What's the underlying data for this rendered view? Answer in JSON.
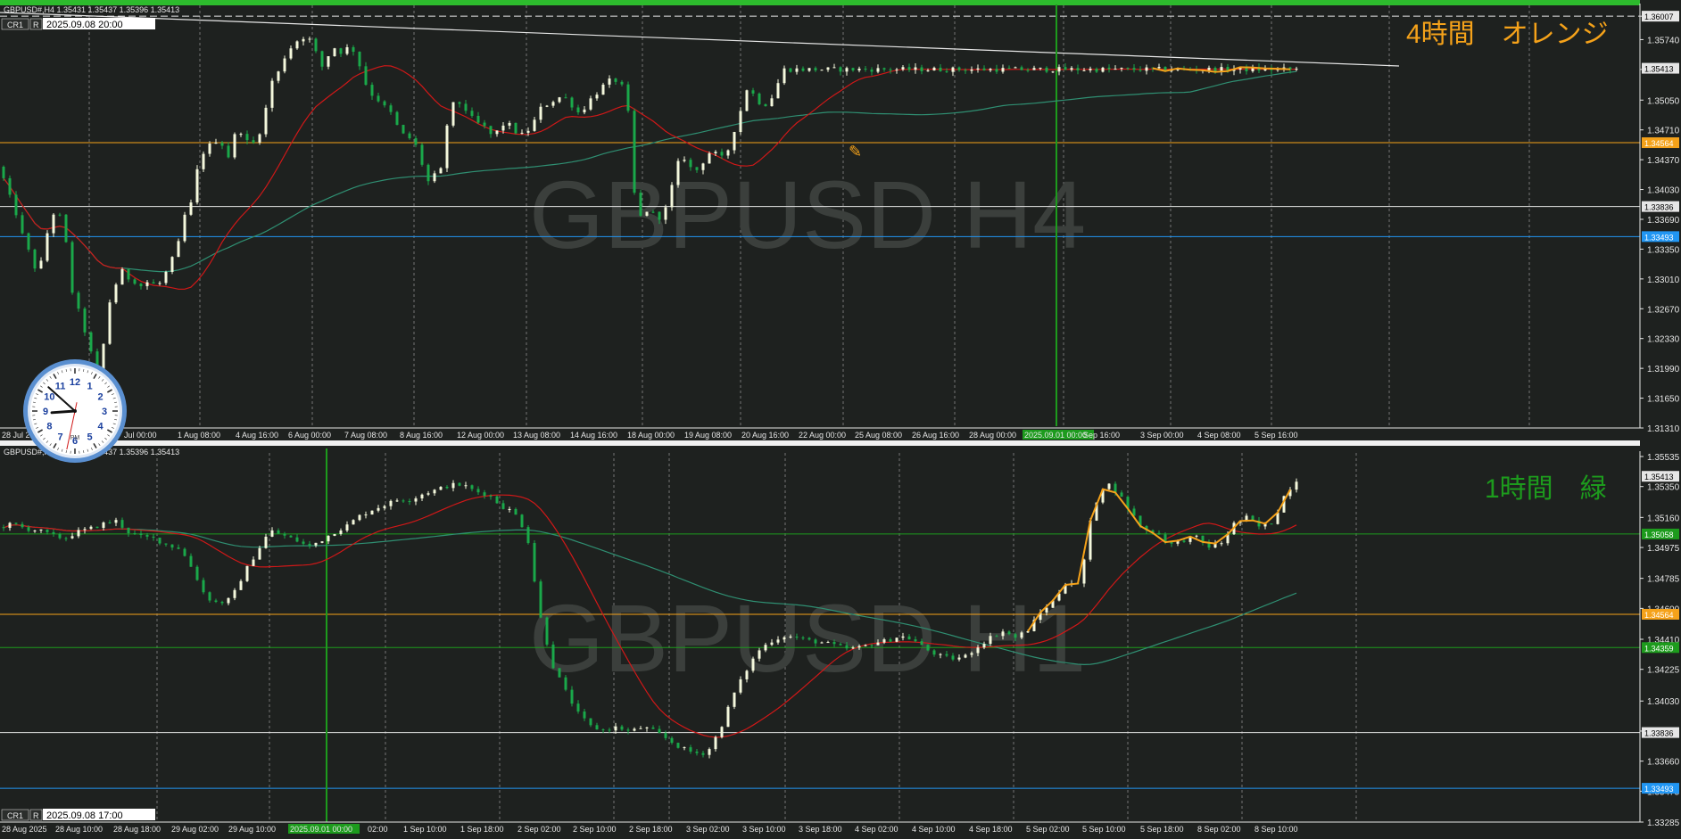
{
  "colors": {
    "background": "#1e211f",
    "axis_text": "#e6e6e6",
    "bull_candle": "#f4f8dc",
    "bear_candle": "#1aa84a",
    "ma_red": "#d01818",
    "ma_teal": "#2f8f72",
    "zigzag_orange": "#f5a21a",
    "watermark": "#3b3f3c",
    "level_orange": "#f5a21a",
    "level_white": "#e6e6e6",
    "level_blue": "#2196f3",
    "level_green": "#1d9b1d",
    "vline_green": "#1d9b1d",
    "grid": "#9a9a9a",
    "top_bar": "#2dbb2d"
  },
  "panels": [
    {
      "id": "h4",
      "info": "GBPUSD#,H4  1.35431 1.35437 1.35396 1.35413",
      "button_cr": "CR1",
      "button_r": "R",
      "datetime": "2025.09.08 20:00",
      "watermark": "GBPUSD H4",
      "note": "4時間　オレンジ",
      "note_color": "#f5a21a",
      "current_price": "1.35413",
      "price_ticks": [
        "1.36007",
        "1.35740",
        "1.35400",
        "1.35050",
        "1.34710",
        "1.34370",
        "1.34030",
        "1.33690",
        "1.33350",
        "1.33010",
        "1.32670",
        "1.32330",
        "1.31990",
        "1.31650",
        "1.31310"
      ],
      "levels": [
        {
          "price": "1.36007",
          "color": "#e6e6e6",
          "style": "dash"
        },
        {
          "price": "1.34564",
          "color": "#f5a21a",
          "style": "solid"
        },
        {
          "price": "1.33836",
          "color": "#e6e6e6",
          "style": "solid"
        },
        {
          "price": "1.33493",
          "color": "#2196f3",
          "style": "solid"
        }
      ],
      "time_labels": [
        "28 Jul 2025",
        "Jul 00:00",
        "1 Aug 08:00",
        "4 Aug 16:00",
        "6 Aug 00:00",
        "7 Aug 08:00",
        "8 Aug 16:00",
        "12 Aug 00:00",
        "13 Aug 08:00",
        "14 Aug 16:00",
        "18 Aug 00:00",
        "19 Aug 08:00",
        "20 Aug 16:00",
        "22 Aug 00:00",
        "25 Aug 08:00",
        "26 Aug 16:00",
        "28 Aug 00:00",
        "2025.09.01 00:00",
        "Sep 16:00",
        "3 Sep 00:00",
        "4 Sep 08:00",
        "5 Sep 16:00"
      ],
      "highlight_time": "2025.09.01 00:00"
    },
    {
      "id": "h1",
      "info": "GBPUSD#,H1  1.35431 1.35437 1.35396 1.35413",
      "button_cr": "CR1",
      "button_r": "R",
      "datetime": "2025.09.08 17:00",
      "watermark": "GBPUSD H1",
      "note": "1時間　緑",
      "note_color": "#1d9b1d",
      "current_price": "1.35413",
      "price_ticks": [
        "1.35535",
        "1.35350",
        "1.35160",
        "1.34975",
        "1.34785",
        "1.34600",
        "1.34410",
        "1.34225",
        "1.34030",
        "1.33845",
        "1.33660",
        "1.33475",
        "1.33285"
      ],
      "levels": [
        {
          "price": "1.35058",
          "color": "#1d9b1d",
          "style": "solid"
        },
        {
          "price": "1.34564",
          "color": "#f5a21a",
          "style": "solid"
        },
        {
          "price": "1.34359",
          "color": "#1d9b1d",
          "style": "solid"
        },
        {
          "price": "1.33836",
          "color": "#e6e6e6",
          "style": "solid"
        },
        {
          "price": "1.33493",
          "color": "#2196f3",
          "style": "solid"
        }
      ],
      "time_labels": [
        "28 Aug 2025",
        "28 Aug 10:00",
        "28 Aug 18:00",
        "29 Aug 02:00",
        "29 Aug 10:00",
        "2025.09.01 00:00",
        "02:00",
        "1 Sep 10:00",
        "1 Sep 18:00",
        "2 Sep 02:00",
        "2 Sep 10:00",
        "2 Sep 18:00",
        "3 Sep 02:00",
        "3 Sep 10:00",
        "3 Sep 18:00",
        "4 Sep 02:00",
        "4 Sep 10:00",
        "4 Sep 18:00",
        "5 Sep 02:00",
        "5 Sep 10:00",
        "5 Sep 18:00",
        "8 Sep 02:00",
        "8 Sep 10:00"
      ],
      "highlight_time": "2025.09.01 00:00"
    }
  ],
  "clock": {
    "numbers": [
      "12",
      "1",
      "2",
      "3",
      "4",
      "5",
      "6",
      "7",
      "8",
      "9",
      "10",
      "11"
    ],
    "ampm": "PM",
    "hour": 8,
    "minute": 52,
    "second": 32
  },
  "chart_data": [
    {
      "type": "candlestick",
      "title": "GBPUSD H4",
      "ylim": [
        1.3131,
        1.3609
      ],
      "x_range": [
        "28 Jul 2025",
        "8 Sep 2025 20:00"
      ],
      "series": [
        {
          "name": "close_path_approx",
          "values": [
            [
              0,
              1.3429
            ],
            [
              8,
              1.3401
            ],
            [
              16,
              1.3383
            ],
            [
              24,
              1.3354
            ],
            [
              32,
              1.3333
            ],
            [
              40,
              1.3312
            ],
            [
              48,
              1.3322
            ],
            [
              56,
              1.3371
            ],
            [
              64,
              1.338
            ],
            [
              72,
              1.336
            ],
            [
              80,
              1.329
            ],
            [
              88,
              1.3265
            ],
            [
              96,
              1.3239
            ],
            [
              104,
              1.321
            ],
            [
              112,
              1.3183
            ],
            [
              120,
              1.3265
            ],
            [
              128,
              1.3289
            ],
            [
              136,
              1.3311
            ],
            [
              144,
              1.3302
            ],
            [
              152,
              1.3298
            ],
            [
              160,
              1.3292
            ],
            [
              168,
              1.33
            ],
            [
              176,
              1.3291
            ],
            [
              184,
              1.3303
            ],
            [
              192,
              1.332
            ],
            [
              200,
              1.334
            ],
            [
              208,
              1.3376
            ],
            [
              216,
              1.3389
            ],
            [
              224,
              1.3441
            ],
            [
              232,
              1.3449
            ],
            [
              240,
              1.3459
            ],
            [
              248,
              1.3458
            ],
            [
              256,
              1.3439
            ],
            [
              264,
              1.3466
            ],
            [
              272,
              1.347
            ],
            [
              280,
              1.3452
            ],
            [
              288,
              1.3459
            ],
            [
              296,
              1.3481
            ],
            [
              304,
              1.3525
            ],
            [
              312,
              1.3535
            ],
            [
              320,
              1.3555
            ],
            [
              328,
              1.3567
            ],
            [
              336,
              1.3575
            ],
            [
              344,
              1.3578
            ],
            [
              352,
              1.3569
            ],
            [
              360,
              1.354
            ],
            [
              368,
              1.3555
            ],
            [
              376,
              1.3565
            ],
            [
              384,
              1.3559
            ],
            [
              392,
              1.3566
            ],
            [
              400,
              1.3559
            ],
            [
              408,
              1.3529
            ],
            [
              416,
              1.3513
            ],
            [
              424,
              1.3506
            ],
            [
              432,
              1.3497
            ],
            [
              440,
              1.3489
            ],
            [
              448,
              1.3471
            ],
            [
              456,
              1.3462
            ],
            [
              464,
              1.3461
            ],
            [
              472,
              1.3439
            ],
            [
              480,
              1.3411
            ],
            [
              488,
              1.3419
            ],
            [
              496,
              1.3426
            ],
            [
              504,
              1.3493
            ],
            [
              512,
              1.3504
            ],
            [
              520,
              1.3499
            ],
            [
              528,
              1.3486
            ],
            [
              536,
              1.3479
            ],
            [
              544,
              1.3474
            ],
            [
              552,
              1.3465
            ],
            [
              560,
              1.347
            ],
            [
              568,
              1.3481
            ],
            [
              576,
              1.3472
            ],
            [
              584,
              1.3464
            ],
            [
              592,
              1.3469
            ],
            [
              600,
              1.3481
            ],
            [
              608,
              1.3497
            ],
            [
              616,
              1.3501
            ],
            [
              624,
              1.3506
            ],
            [
              632,
              1.351
            ],
            [
              640,
              1.3503
            ],
            [
              648,
              1.349
            ],
            [
              656,
              1.3496
            ],
            [
              664,
              1.3507
            ],
            [
              672,
              1.3515
            ],
            [
              680,
              1.3524
            ],
            [
              688,
              1.3529
            ],
            [
              696,
              1.3525
            ],
            [
              704,
              1.351
            ],
            [
              712,
              1.34
            ],
            [
              720,
              1.337
            ],
            [
              728,
              1.3381
            ],
            [
              736,
              1.3373
            ],
            [
              744,
              1.337
            ],
            [
              752,
              1.3395
            ],
            [
              760,
              1.3431
            ],
            [
              768,
              1.344
            ],
            [
              776,
              1.3427
            ],
            [
              784,
              1.3425
            ],
            [
              792,
              1.3439
            ],
            [
              800,
              1.3449
            ],
            [
              808,
              1.3437
            ],
            [
              816,
              1.3443
            ],
            [
              824,
              1.3469
            ],
            [
              832,
              1.3494
            ],
            [
              840,
              1.3522
            ],
            [
              848,
              1.3508
            ],
            [
              856,
              1.3499
            ],
            [
              864,
              1.3502
            ],
            [
              872,
              1.352
            ],
            [
              880,
              1.354
            ]
          ]
        }
      ]
    },
    {
      "type": "candlestick",
      "title": "GBPUSD H1",
      "ylim": [
        1.33285,
        1.35535
      ],
      "x_range": [
        "28 Aug 2025",
        "8 Sep 2025 17:00"
      ],
      "series": [
        {
          "name": "close_path_approx",
          "values": [
            [
              0,
              1.351
            ],
            [
              10,
              1.3512
            ],
            [
              20,
              1.3509
            ],
            [
              30,
              1.3508
            ],
            [
              40,
              1.3505
            ],
            [
              50,
              1.3503
            ],
            [
              60,
              1.3507
            ],
            [
              70,
              1.3509
            ],
            [
              80,
              1.3512
            ],
            [
              90,
              1.3514
            ],
            [
              100,
              1.3507
            ],
            [
              110,
              1.3504
            ],
            [
              120,
              1.3503
            ],
            [
              130,
              1.3499
            ],
            [
              140,
              1.3497
            ],
            [
              150,
              1.3484
            ],
            [
              160,
              1.3467
            ],
            [
              170,
              1.3463
            ],
            [
              180,
              1.3466
            ],
            [
              190,
              1.3482
            ],
            [
              200,
              1.3495
            ],
            [
              210,
              1.3508
            ],
            [
              220,
              1.3505
            ],
            [
              230,
              1.3502
            ],
            [
              240,
              1.3498
            ],
            [
              250,
              1.3502
            ],
            [
              260,
              1.3507
            ],
            [
              270,
              1.3511
            ],
            [
              280,
              1.3517
            ],
            [
              290,
              1.3521
            ],
            [
              300,
              1.3524
            ],
            [
              310,
              1.3527
            ],
            [
              320,
              1.3527
            ],
            [
              330,
              1.3531
            ],
            [
              340,
              1.3533
            ],
            [
              350,
              1.3536
            ],
            [
              360,
              1.3536
            ],
            [
              370,
              1.3532
            ],
            [
              380,
              1.353
            ],
            [
              390,
              1.3523
            ],
            [
              400,
              1.3519
            ],
            [
              410,
              1.3506
            ],
            [
              420,
              1.3456
            ],
            [
              430,
              1.3425
            ],
            [
              440,
              1.3409
            ],
            [
              450,
              1.3395
            ],
            [
              460,
              1.3387
            ],
            [
              470,
              1.3385
            ],
            [
              480,
              1.3387
            ],
            [
              490,
              1.3384
            ],
            [
              500,
              1.3387
            ],
            [
              510,
              1.3384
            ],
            [
              520,
              1.3379
            ],
            [
              530,
              1.3374
            ],
            [
              540,
              1.3371
            ],
            [
              550,
              1.3371
            ],
            [
              560,
              1.3385
            ],
            [
              570,
              1.3406
            ],
            [
              580,
              1.3421
            ],
            [
              590,
              1.3434
            ],
            [
              600,
              1.344
            ],
            [
              610,
              1.3443
            ],
            [
              620,
              1.3442
            ],
            [
              630,
              1.344
            ],
            [
              640,
              1.3439
            ],
            [
              650,
              1.3437
            ],
            [
              660,
              1.3435
            ],
            [
              670,
              1.3436
            ],
            [
              680,
              1.3439
            ],
            [
              690,
              1.344
            ],
            [
              700,
              1.3443
            ],
            [
              710,
              1.3441
            ],
            [
              720,
              1.3435
            ],
            [
              730,
              1.3431
            ],
            [
              740,
              1.3429
            ],
            [
              750,
              1.343
            ],
            [
              760,
              1.3436
            ],
            [
              770,
              1.3442
            ],
            [
              780,
              1.3446
            ],
            [
              790,
              1.3442
            ],
            [
              800,
              1.3447
            ],
            [
              810,
              1.3458
            ],
            [
              820,
              1.3465
            ],
            [
              830,
              1.3477
            ],
            [
              840,
              1.3474
            ],
            [
              850,
              1.3521
            ],
            [
              860,
              1.3538
            ],
            [
              870,
              1.3531
            ],
            [
              880,
              1.3519
            ],
            [
              890,
              1.3508
            ],
            [
              900,
              1.3507
            ],
            [
              910,
              1.3499
            ],
            [
              920,
              1.3502
            ],
            [
              930,
              1.3504
            ],
            [
              940,
              1.3498
            ],
            [
              950,
              1.35
            ],
            [
              960,
              1.3512
            ],
            [
              970,
              1.3516
            ],
            [
              980,
              1.351
            ],
            [
              990,
              1.3513
            ],
            [
              1000,
              1.3531
            ],
            [
              1010,
              1.354
            ]
          ]
        }
      ]
    }
  ]
}
